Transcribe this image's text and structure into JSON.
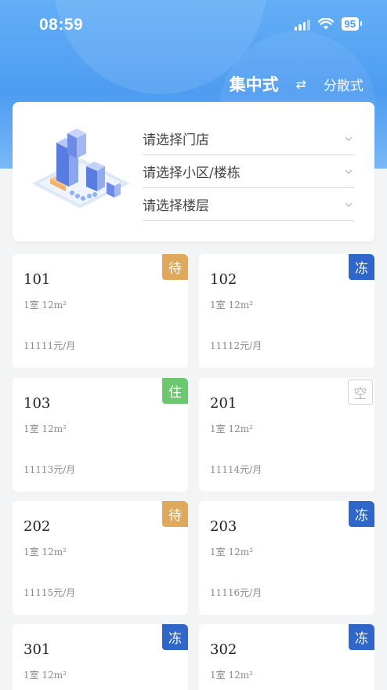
{
  "status_bar": {
    "time": "08:59",
    "battery": "95"
  },
  "mode": {
    "active": "集中式",
    "swap_icon": "⇄",
    "inactive": "分散式"
  },
  "filters": {
    "store": "请选择门店",
    "community": "请选择小区/楼栋",
    "floor": "请选择楼层"
  },
  "colors": {
    "header": "#4d9cf2",
    "pending": "#e0a85a",
    "frozen": "#2e66c9",
    "occupied": "#6cc86e",
    "vacant_border": "#d0d0d0"
  },
  "rooms": [
    {
      "number": "101",
      "spec": "1室 12m²",
      "price": "11111元/月",
      "status": "待",
      "status_type": "pending"
    },
    {
      "number": "102",
      "spec": "1室 12m²",
      "price": "11112元/月",
      "status": "冻",
      "status_type": "frozen"
    },
    {
      "number": "103",
      "spec": "1室 12m²",
      "price": "11113元/月",
      "status": "住",
      "status_type": "occupied"
    },
    {
      "number": "201",
      "spec": "1室 12m²",
      "price": "11114元/月",
      "status": "空",
      "status_type": "vacant"
    },
    {
      "number": "202",
      "spec": "1室 12m²",
      "price": "11115元/月",
      "status": "待",
      "status_type": "pending"
    },
    {
      "number": "203",
      "spec": "1室 12m²",
      "price": "11116元/月",
      "status": "冻",
      "status_type": "frozen"
    },
    {
      "number": "301",
      "spec": "1室 12m²",
      "price": "",
      "status": "冻",
      "status_type": "frozen"
    },
    {
      "number": "302",
      "spec": "1室 12m²",
      "price": "",
      "status": "冻",
      "status_type": "frozen"
    }
  ]
}
